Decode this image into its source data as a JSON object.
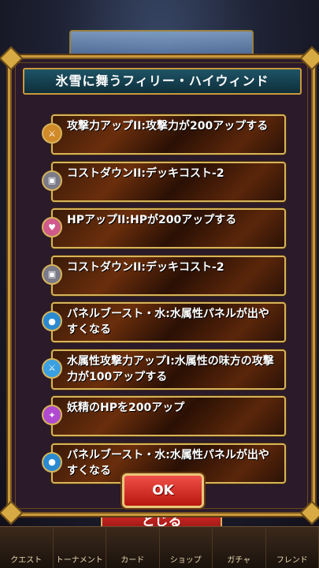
{
  "dialog": {
    "title": "氷雪に舞うフィリー・ハイウィンド",
    "ok_label": "OK"
  },
  "skills": [
    {
      "text": "攻撃力アップII:攻撃力が200アップする",
      "icon": "sword-icon",
      "icon_color": "#d08a28"
    },
    {
      "text": "コストダウンII:デッキコスト-2",
      "icon": "cost-icon",
      "icon_color": "#7a7a88"
    },
    {
      "text": "HPアップII:HPが200アップする",
      "icon": "heart-icon",
      "icon_color": "#d05a8a"
    },
    {
      "text": "コストダウンII:デッキコスト-2",
      "icon": "cost-icon",
      "icon_color": "#7a7a88"
    },
    {
      "text": "パネルブースト・水:水属性パネルが出やすくなる",
      "icon": "water-panel-icon",
      "icon_color": "#2a8ad0"
    },
    {
      "text": "水属性攻撃力アップI:水属性の味方の攻撃力が100アップする",
      "icon": "water-sword-icon",
      "icon_color": "#3aa0e0"
    },
    {
      "text": "妖精のHPを200アップ",
      "icon": "fairy-icon",
      "icon_color": "#b04ad0"
    },
    {
      "text": "パネルブースト・水:水属性パネルが出やすくなる",
      "icon": "water-panel-icon",
      "icon_color": "#2a8ad0"
    }
  ],
  "background": {
    "close_label": "とじる",
    "nav": [
      "クエスト",
      "トーナメント",
      "カード",
      "ショップ",
      "ガチャ",
      "フレンド"
    ]
  }
}
